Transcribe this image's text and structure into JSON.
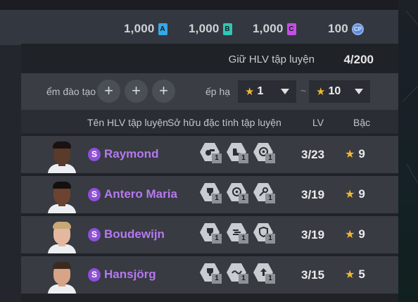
{
  "currencies": [
    {
      "amount": "1,000",
      "badge": "A",
      "color": "#35a8e8"
    },
    {
      "amount": "1,000",
      "badge": "B",
      "color": "#2ec7b8"
    },
    {
      "amount": "1,000",
      "badge": "C",
      "color": "#c44ee6"
    },
    {
      "amount": "100",
      "badge": "CP",
      "color": "#5b88d6"
    }
  ],
  "capacity": {
    "label": "Giữ HLV tập luyện",
    "value": "4/200"
  },
  "filters": {
    "slot_label": "ểm đào tạo",
    "slot_plus": "+",
    "rank_label": "ếp hạ",
    "rank_min": "1",
    "rank_max": "10",
    "separator": "~",
    "star": "★"
  },
  "columns": {
    "name": "Tên HLV tập luyện",
    "traits": "Sở hữu đặc tính tập luyện",
    "lv": "LV",
    "grade": "Bậc"
  },
  "coaches": [
    {
      "tier": "S",
      "name": "Raymond",
      "lv": "3/23",
      "grade": "9",
      "traits": [
        "1",
        "1",
        "1"
      ],
      "skin": "#5a3a2a",
      "hair": "#1a1210"
    },
    {
      "tier": "S",
      "name": "Antero Maria",
      "lv": "3/19",
      "grade": "9",
      "traits": [
        "1",
        "1",
        "1"
      ],
      "skin": "#6b4330",
      "hair": "#141010"
    },
    {
      "tier": "S",
      "name": "Boudewijn",
      "lv": "3/19",
      "grade": "9",
      "traits": [
        "1",
        "1",
        "1"
      ],
      "skin": "#e3b89f",
      "hair": "#c9a877"
    },
    {
      "tier": "S",
      "name": "Hansjörg",
      "lv": "3/15",
      "grade": "5",
      "traits": [
        "1",
        "1",
        "1"
      ],
      "skin": "#d7a487",
      "hair": "#3b2a20"
    }
  ]
}
